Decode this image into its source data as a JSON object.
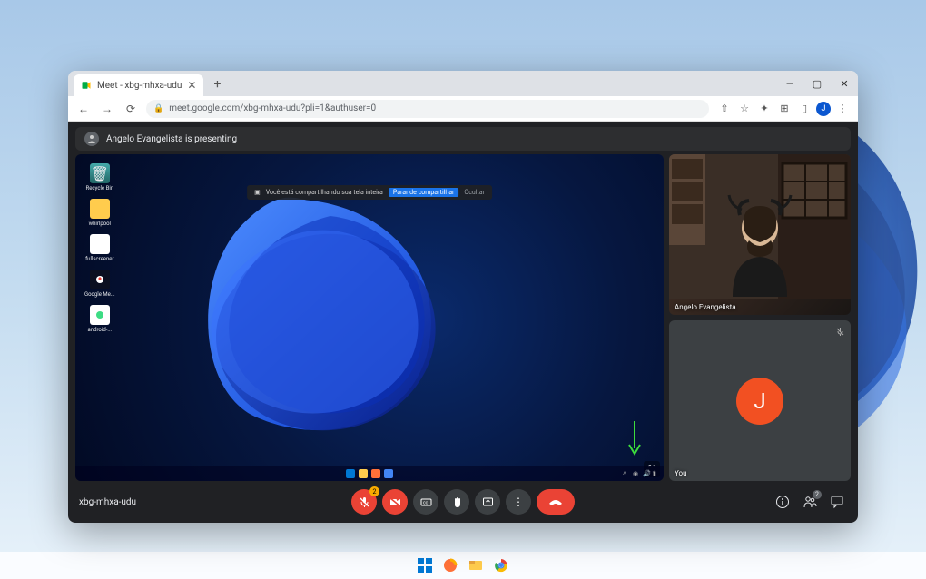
{
  "host_taskbar": {
    "icons": [
      "start",
      "firefox",
      "file-explorer",
      "chrome"
    ]
  },
  "browser": {
    "tab": {
      "title": "Meet - xbg-mhxa-udu"
    },
    "window_controls": {
      "min": "—",
      "max": "▢",
      "close": "✕"
    },
    "nav": {
      "back": "←",
      "forward": "→",
      "reload": "⟳"
    },
    "url": "meet.google.com/xbg-mhxa-udu?pli=1&authuser=0",
    "ext_icons": [
      "share",
      "star",
      "extensions",
      "puzzle",
      "cast"
    ],
    "avatar_initial": "J"
  },
  "meet": {
    "banner_text": "Angelo Evangelista is presenting",
    "share_notice": {
      "text": "Você está compartilhando sua tela inteira",
      "stop": "Parar de compartilhar",
      "hide": "Ocultar"
    },
    "desktop_icons": [
      {
        "label": "Recycle Bin",
        "kind": "recycle"
      },
      {
        "label": "whirlpool",
        "kind": "folder"
      },
      {
        "label": "fullscreener",
        "kind": "file"
      },
      {
        "label": "Google Me...",
        "kind": "shortcut-g"
      },
      {
        "label": "android-...",
        "kind": "shortcut-a"
      }
    ],
    "participants": [
      {
        "name": "Angelo Evangelista",
        "type": "video"
      },
      {
        "name": "You",
        "type": "avatar",
        "initial": "J",
        "muted": true
      }
    ],
    "meeting_code": "xbg-mhxa-udu",
    "controls": {
      "mic_badge": "2",
      "people_badge": "2"
    }
  }
}
